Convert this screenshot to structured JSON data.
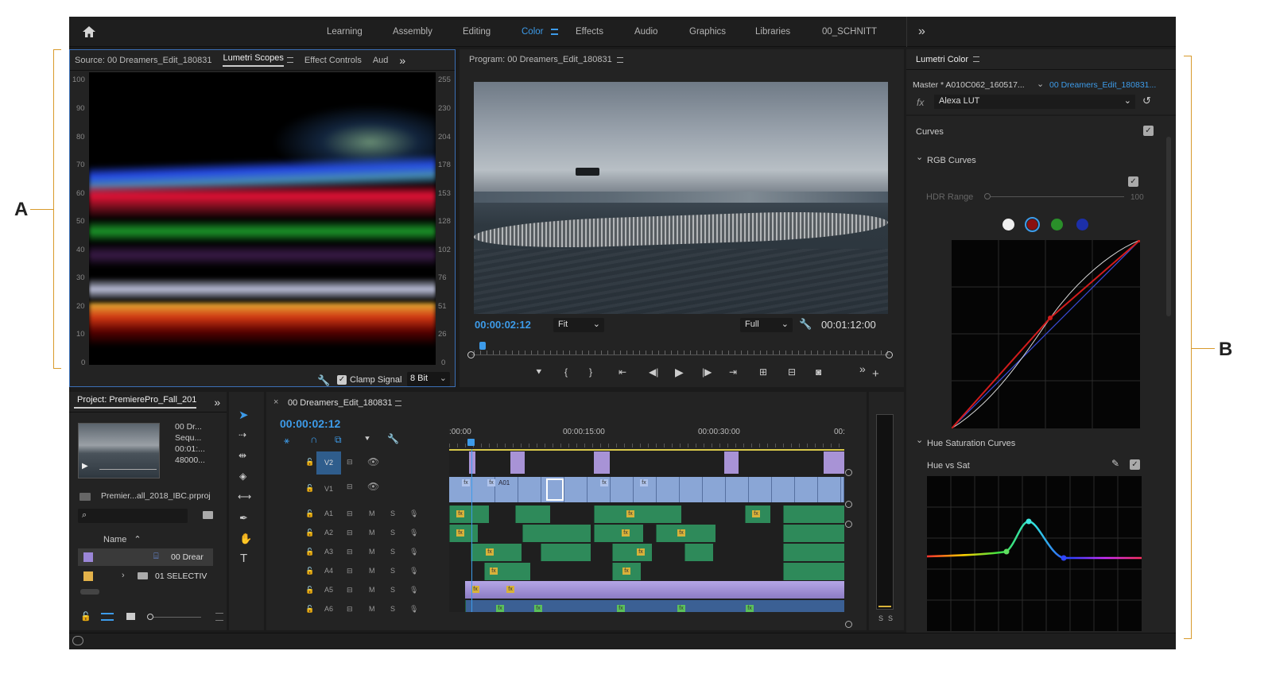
{
  "callouts": {
    "a": "A",
    "b": "B"
  },
  "workspaces": [
    "Learning",
    "Assembly",
    "Editing",
    "Color",
    "Effects",
    "Audio",
    "Graphics",
    "Libraries",
    "00_SCHNITT"
  ],
  "overflow_glyph": "»",
  "source_panel": {
    "tab_source": "Source: 00 Dreamers_Edit_180831",
    "tab_scopes": "Lumetri Scopes",
    "tab_effects": "Effect Controls",
    "tab_audio": "Aud",
    "left_scale": [
      "100",
      "90",
      "80",
      "70",
      "60",
      "50",
      "40",
      "30",
      "20",
      "10",
      "0"
    ],
    "right_scale": [
      "255",
      "230",
      "204",
      "178",
      "153",
      "128",
      "102",
      "76",
      "51",
      "26",
      "0"
    ],
    "clamp_label": "Clamp Signal",
    "bit_depth": "8 Bit"
  },
  "program": {
    "title": "Program: 00 Dreamers_Edit_180831",
    "timecode": "00:00:02:12",
    "fit": "Fit",
    "quality": "Full",
    "duration": "00:01:12:00"
  },
  "lumetri": {
    "title": "Lumetri Color",
    "master": "Master * A010C062_160517...",
    "sequence": "00 Dreamers_Edit_180831...",
    "fx_label": "fx",
    "lut": "Alexa LUT",
    "curves": "Curves",
    "rgb_curves": "RGB Curves",
    "hdr_range": "HDR Range",
    "hdr_value": "100",
    "hue_sat": "Hue Saturation Curves",
    "hue_vs_sat": "Hue vs Sat",
    "colors": {
      "accent": "#3d9be9",
      "red": "#c81e1e",
      "green": "#2a8f2a",
      "blue": "#1c2fa8"
    }
  },
  "project": {
    "title": "Project: PremierePro_Fall_201",
    "clip_lines": [
      "00 Dr...",
      "Sequ...",
      "00:01:...",
      "48000..."
    ],
    "file": "Premier...all_2018_IBC.prproj",
    "name_col": "Name",
    "rows": [
      "00 Drear",
      "01 SELECTIV"
    ]
  },
  "timeline": {
    "title": "00 Dreamers_Edit_180831",
    "timecode": "00:00:02:12",
    "ruler": [
      ":00:00",
      "00:00:15:00",
      "00:00:30:00",
      "00:"
    ],
    "video_tracks": [
      "V2",
      "V1"
    ],
    "audio_tracks": [
      "A1",
      "A2",
      "A3",
      "A4",
      "A5",
      "A6"
    ],
    "clip_label": "A01",
    "meter_labels": [
      "S",
      "S"
    ],
    "track_m": "M",
    "track_s": "S"
  }
}
